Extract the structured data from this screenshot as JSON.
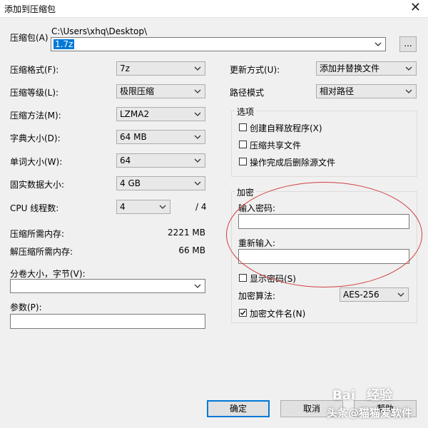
{
  "window": {
    "title": "添加到压缩包"
  },
  "archive": {
    "label": "压缩包(A)",
    "path": "C:\\Users\\xhq\\Desktop\\",
    "filename": "1.7z",
    "browse_label": "..."
  },
  "settings": [
    {
      "label": "压缩格式(F):",
      "value": "7z"
    },
    {
      "label": "压缩等级(L):",
      "value": "极限压缩"
    },
    {
      "label": "压缩方法(M):",
      "value": "LZMA2"
    },
    {
      "label": "字典大小(D):",
      "value": "64 MB"
    },
    {
      "label": "单词大小(W):",
      "value": "64"
    },
    {
      "label": "固实数据大小:",
      "value": "4 GB"
    }
  ],
  "cpu": {
    "label": "CPU 线程数:",
    "value": "4",
    "total": "/ 4"
  },
  "memory": {
    "compress_label": "压缩所需内存:",
    "compress_value": "2221 MB",
    "decompress_label": "解压缩所需内存:",
    "decompress_value": "66 MB"
  },
  "split": {
    "label": "分卷大小，字节(V):",
    "value": ""
  },
  "params": {
    "label": "参数(P):",
    "value": ""
  },
  "update": {
    "label": "更新方式(U):",
    "value": "添加并替换文件"
  },
  "pathmode": {
    "label": "路径模式",
    "value": "相对路径"
  },
  "options": {
    "title": "选项",
    "items": [
      {
        "label": "创建自释放程序(X)",
        "checked": false
      },
      {
        "label": "压缩共享文件",
        "checked": false
      },
      {
        "label": "操作完成后删除源文件",
        "checked": false
      }
    ]
  },
  "encryption": {
    "title": "加密",
    "password_label": "输入密码:",
    "password_value": "",
    "reenter_label": "重新输入:",
    "reenter_value": "",
    "show_password_label": "显示密码(S)",
    "show_password_checked": false,
    "method_label": "加密算法:",
    "method_value": "AES-256",
    "encrypt_names_label": "加密文件名(N)",
    "encrypt_names_checked": true
  },
  "buttons": {
    "ok": "确定",
    "cancel": "取消",
    "help": "帮助"
  },
  "watermark": {
    "baidu": "Bai",
    "jingyan": "经验",
    "author": "头条@猫猫爱软件"
  },
  "colors": {
    "accent": "#0078d7",
    "annotation": "#d04040"
  }
}
